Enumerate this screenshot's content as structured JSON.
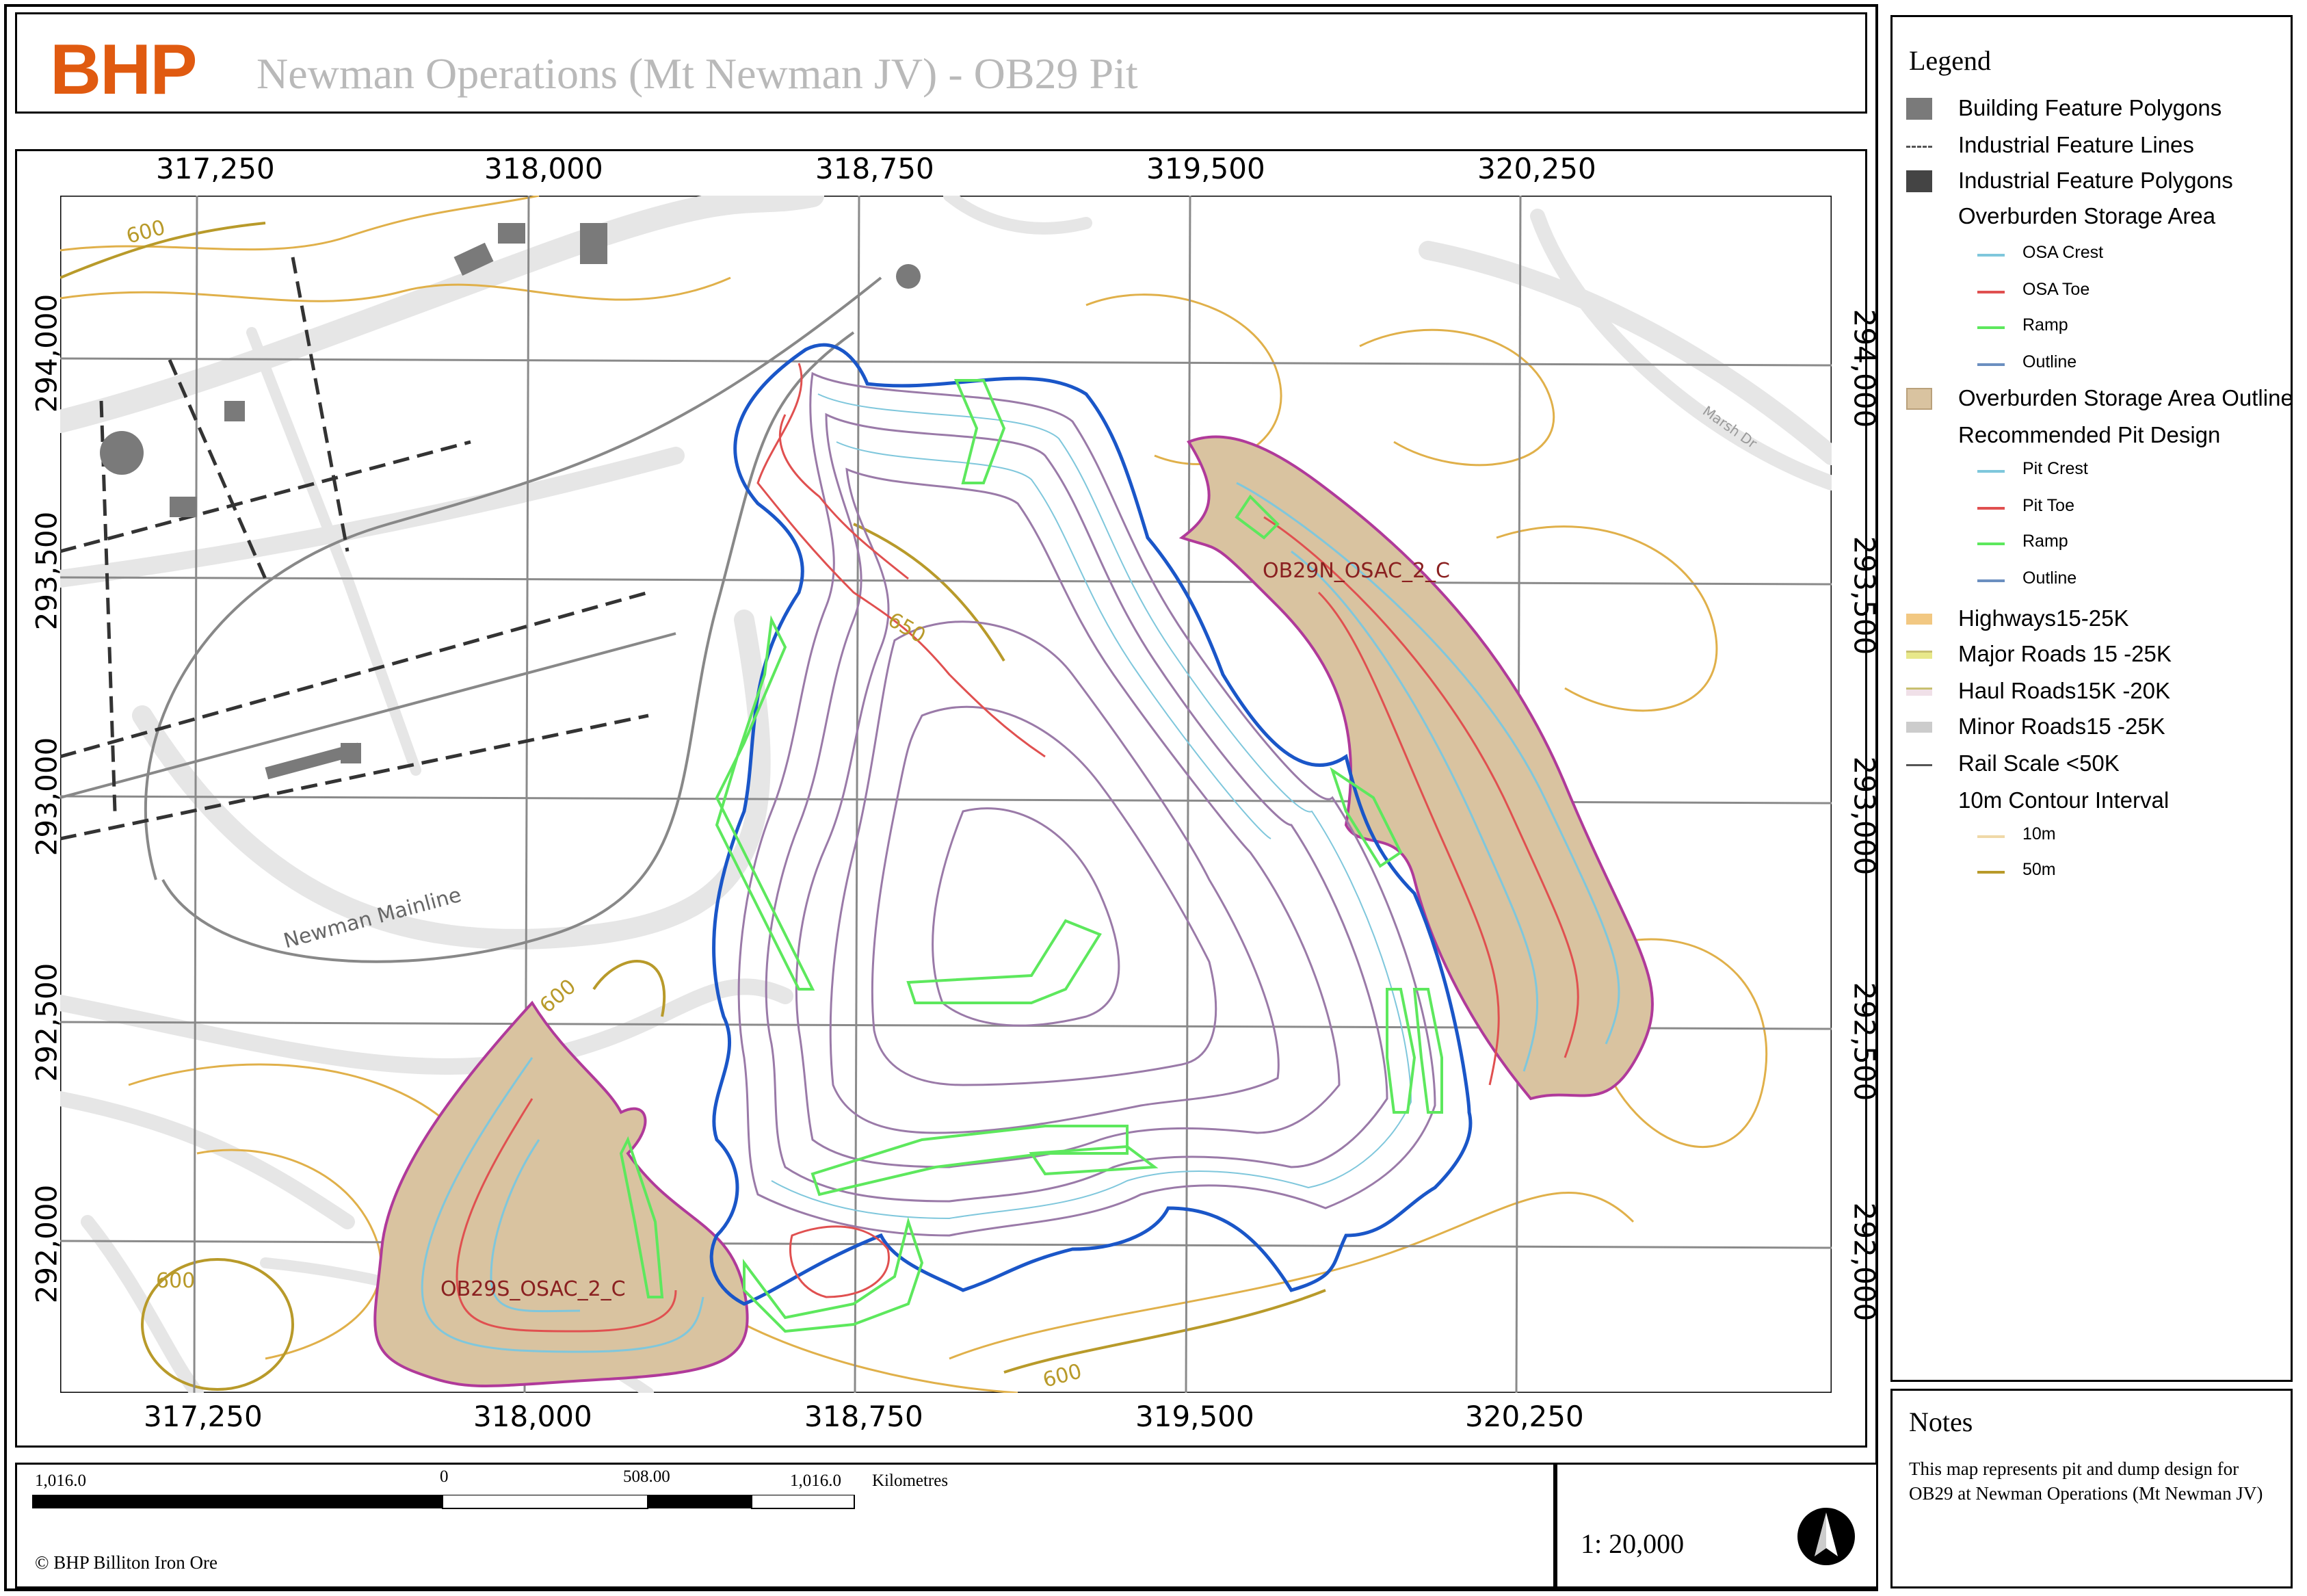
{
  "header": {
    "logo": "BHP",
    "title": "Newman Operations (Mt Newman JV)  - OB29 Pit"
  },
  "map": {
    "x_ticks_top": [
      "317,250",
      "318,000",
      "318,750",
      "319,500",
      "320,250"
    ],
    "x_ticks_bottom": [
      "317,250",
      "318,000",
      "318,750",
      "319,500",
      "320,250"
    ],
    "y_ticks_left": [
      "294,000",
      "293,500",
      "293,000",
      "292,500",
      "292,000"
    ],
    "y_ticks_right": [
      "294,000",
      "293,500",
      "293,000",
      "292,500",
      "292,000"
    ],
    "labels": {
      "osa_north": "OB29N_OSAC_2_C",
      "osa_south": "OB29S_OSAC_2_C",
      "railway": "Newman Mainline",
      "road": "Marsh Dr",
      "contour_600_a": "600",
      "contour_600_b": "600",
      "contour_600_c": "600",
      "contour_600_d": "600",
      "contour_650": "650"
    },
    "colors": {
      "osa_fill": "#d9c3a0",
      "osa_outline": "#b03a9a",
      "pit_outline": "#1a56c8",
      "crest": "#7fc7dc",
      "toe": "#e05050",
      "ramp": "#5de85d",
      "contour": "#d9a637",
      "grid": "#8a8a8a",
      "road": "#e6e6e6"
    }
  },
  "legend": {
    "title": "Legend",
    "items": [
      {
        "label": "Building Feature Polygons",
        "sym": "square",
        "color": "#7a7a7a"
      },
      {
        "label": "Industrial Feature Lines",
        "sym": "dash",
        "color": "#555555"
      },
      {
        "label": "Industrial Feature Polygons",
        "sym": "square",
        "color": "#444444"
      },
      {
        "label": "Overburden Storage Area",
        "sym": "none",
        "color": ""
      },
      {
        "label": "OSA Crest",
        "sym": "subline",
        "color": "#7fc7dc"
      },
      {
        "label": "OSA Toe",
        "sym": "subline",
        "color": "#e05050"
      },
      {
        "label": "Ramp",
        "sym": "subline",
        "color": "#5de85d"
      },
      {
        "label": "Outline",
        "sym": "subline",
        "color": "#6b8fc0"
      },
      {
        "label": "Overburden Storage Area Outline",
        "sym": "osa",
        "color": "#d9c3a0"
      },
      {
        "label": "Recommended Pit Design",
        "sym": "none",
        "color": ""
      },
      {
        "label": "Pit Crest",
        "sym": "subline",
        "color": "#7fc7dc"
      },
      {
        "label": "Pit Toe",
        "sym": "subline",
        "color": "#e05050"
      },
      {
        "label": "Ramp",
        "sym": "subline",
        "color": "#5de85d"
      },
      {
        "label": "Outline",
        "sym": "subline",
        "color": "#6b8fc0"
      },
      {
        "label": "Highways15-25K",
        "sym": "bar",
        "color": "#f2c882"
      },
      {
        "label": "Major Roads 15    -25K",
        "sym": "barline",
        "color": "#e8e88a"
      },
      {
        "label": "Haul Roads15K     -20K",
        "sym": "barline",
        "color": "#f0e0e8"
      },
      {
        "label": "Minor Roads15     -25K",
        "sym": "bar",
        "color": "#cccccc"
      },
      {
        "label": "Rail Scale <50K",
        "sym": "rail",
        "color": "#555555"
      },
      {
        "label": "10m Contour Interval",
        "sym": "none",
        "color": ""
      },
      {
        "label": "10m",
        "sym": "subline",
        "color": "#f0d9a8"
      },
      {
        "label": "50m",
        "sym": "subline",
        "color": "#b89a2a"
      }
    ]
  },
  "notes": {
    "title": "Notes",
    "text": "This map represents pit and dump design for OB29 at Newman Operations (Mt Newman JV)"
  },
  "scalebar": {
    "left": "1,016.0",
    "zero": "0",
    "mid": "508.00",
    "right": "1,016.0",
    "unit": "Kilometres",
    "copyright": "© BHP Billiton Iron Ore"
  },
  "ratio": "1:   20,000"
}
